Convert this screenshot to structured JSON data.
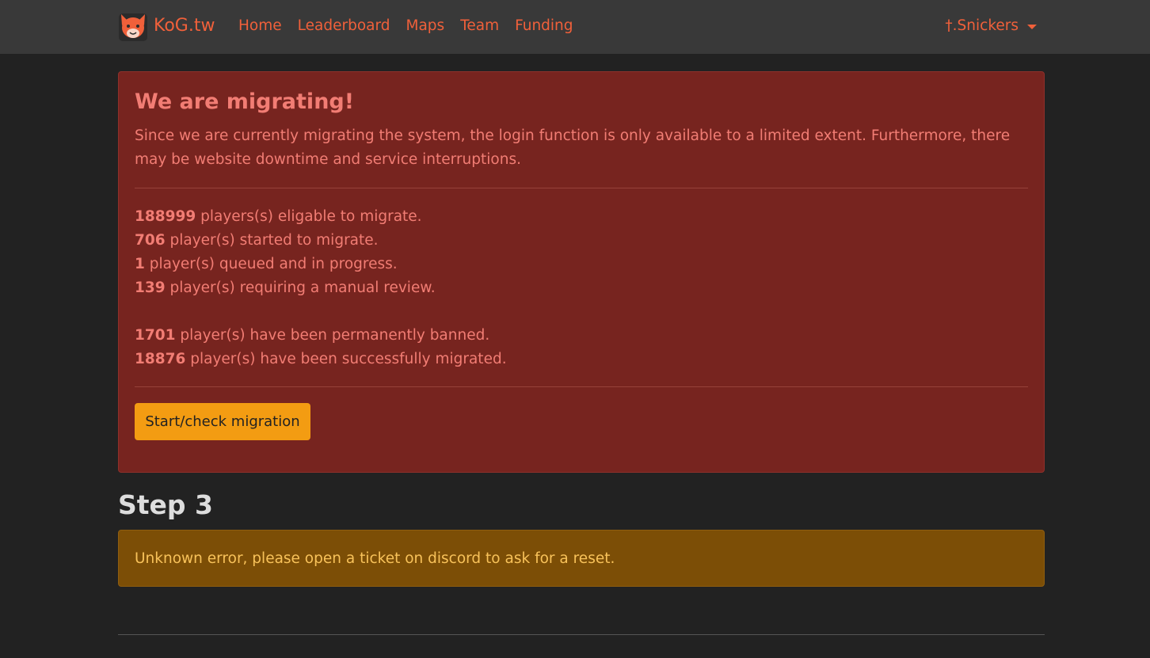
{
  "navbar": {
    "brand": "KoG.tw",
    "logo_icon": "fox-logo-icon",
    "links": [
      "Home",
      "Leaderboard",
      "Maps",
      "Team",
      "Funding"
    ],
    "user": "†.Snickers"
  },
  "migration_alert": {
    "heading": "We are migrating!",
    "intro": "Since we are currently migrating the system, the login function is only available to a limited extent. Furthermore, there may be website downtime and service interruptions.",
    "stats": [
      {
        "count": "188999",
        "text": " players(s) eligable to migrate."
      },
      {
        "count": "706",
        "text": " player(s) started to migrate."
      },
      {
        "count": "1",
        "text": " player(s) queued and in progress."
      },
      {
        "count": "139",
        "text": " player(s) requiring a manual review."
      }
    ],
    "stats_outcome": [
      {
        "count": "1701",
        "text": " player(s) have been permanently banned."
      },
      {
        "count": "18876",
        "text": " player(s) have been successfully migrated."
      }
    ],
    "button_label": "Start/check migration"
  },
  "step": {
    "heading": "Step 3",
    "warning": "Unknown error, please open a ticket on discord to ask for a reset."
  },
  "colors": {
    "page_bg": "#222222",
    "navbar_bg": "#393939",
    "brand_accent": "#f0603a",
    "danger_bg": "#77241f",
    "danger_text": "#f27d74",
    "warning_bg": "#7c4e06",
    "warning_text": "#f8c25a",
    "button_bg": "#f39c12"
  }
}
